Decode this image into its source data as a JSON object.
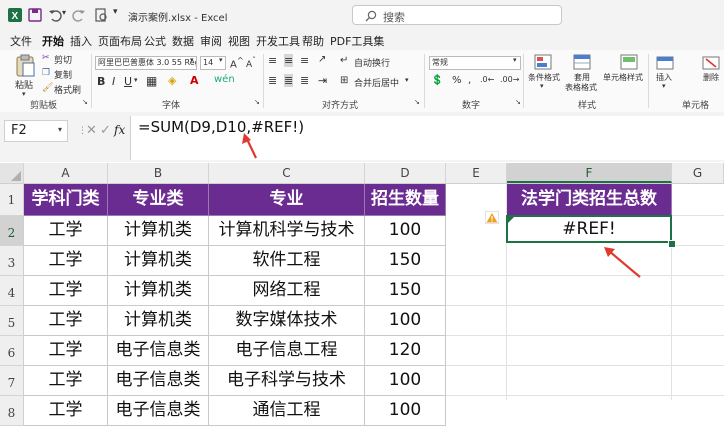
{
  "title_bar": {
    "filename": "演示案例.xlsx",
    "separator": "-",
    "app_name": "Excel",
    "search_placeholder": "搜索"
  },
  "menu": {
    "tabs": [
      "文件",
      "开始",
      "插入",
      "页面布局",
      "公式",
      "数据",
      "审阅",
      "视图",
      "开发工具",
      "帮助",
      "PDF工具集"
    ],
    "active": "开始"
  },
  "ribbon": {
    "clipboard": {
      "paste": "粘贴",
      "cut": "剪切",
      "copy": "复制",
      "format_painter": "格式刷",
      "label": "剪贴板"
    },
    "font": {
      "font_name": "阿里巴巴普惠体 3.0 55 Regu",
      "font_size": "14",
      "label": "字体"
    },
    "alignment": {
      "wrap": "自动换行",
      "merge": "合并后居中",
      "label": "对齐方式"
    },
    "number": {
      "format": "常规",
      "label": "数字"
    },
    "styles": {
      "conditional": "条件格式",
      "table": "套用",
      "table2": "表格格式",
      "cell_styles": "单元格样式",
      "label": "样式"
    },
    "cells": {
      "insert": "插入",
      "delete": "删除",
      "label": "单元格"
    }
  },
  "formula_bar": {
    "name_box": "F2",
    "fx": "fx",
    "formula": "=SUM(D9,D10,#REF!)"
  },
  "sheet": {
    "columns": [
      "A",
      "B",
      "C",
      "D",
      "E",
      "F",
      "G"
    ],
    "rows": [
      "1",
      "2",
      "3",
      "4",
      "5",
      "6",
      "7",
      "8"
    ],
    "headers": [
      "学科门类",
      "专业类",
      "专业",
      "招生数量"
    ],
    "data": [
      [
        "工学",
        "计算机类",
        "计算机科学与技术",
        "100"
      ],
      [
        "工学",
        "计算机类",
        "软件工程",
        "150"
      ],
      [
        "工学",
        "计算机类",
        "网络工程",
        "150"
      ],
      [
        "工学",
        "计算机类",
        "数字媒体技术",
        "100"
      ],
      [
        "工学",
        "电子信息类",
        "电子信息工程",
        "120"
      ],
      [
        "工学",
        "电子信息类",
        "电子科学与技术",
        "100"
      ],
      [
        "工学",
        "电子信息类",
        "通信工程",
        "100"
      ]
    ],
    "f_header": "法学门类招生总数",
    "f_value": "#REF!",
    "selected_cell": "F2"
  },
  "colors": {
    "header_fill": "#6a2c91",
    "accent": "#1e7145",
    "arrow": "#e03a2f",
    "warning": "#f0a020"
  }
}
